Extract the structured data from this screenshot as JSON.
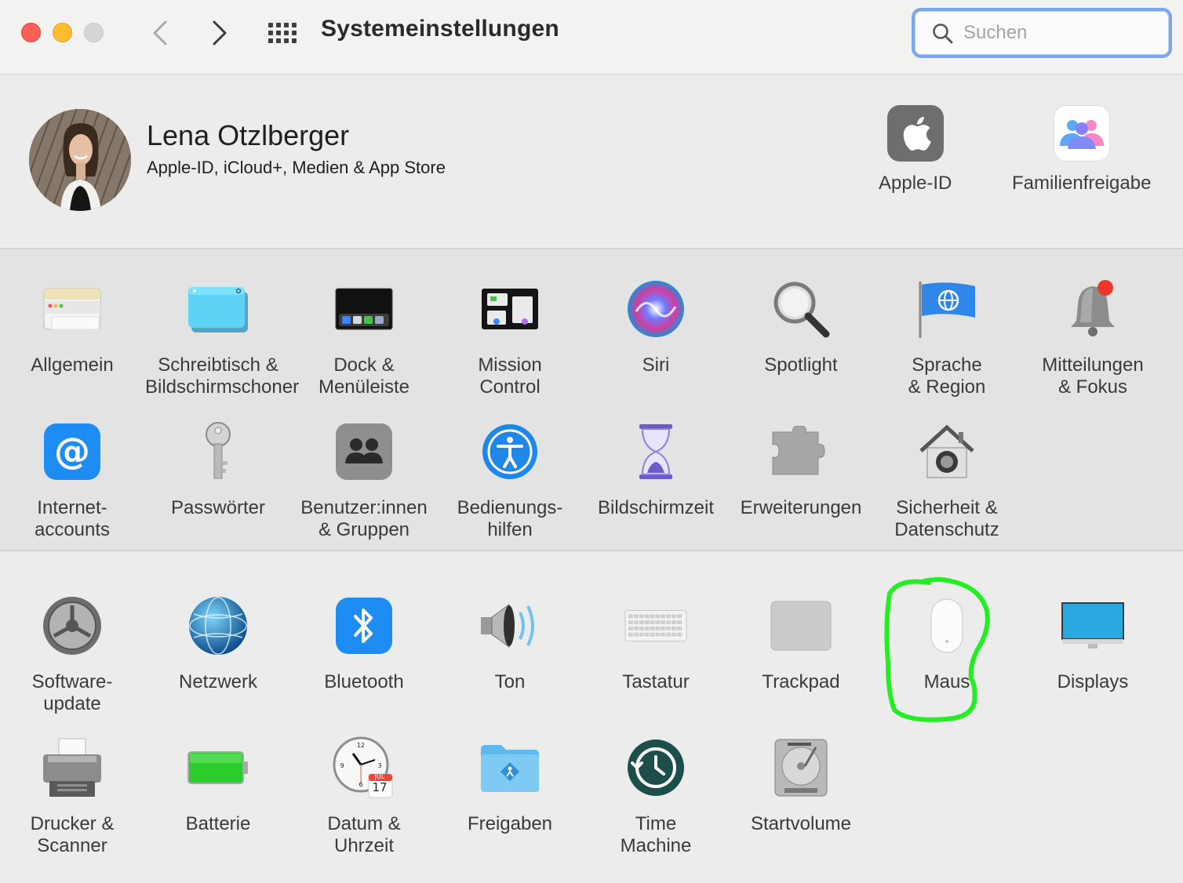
{
  "window": {
    "title": "Systemeinstellungen",
    "search_placeholder": "Suchen"
  },
  "account": {
    "name": "Lena Otzlberger",
    "subtitle": "Apple-ID, iCloud+, Medien & App Store",
    "apple_id_label": "Apple-ID",
    "family_label": "Familienfreigabe"
  },
  "row1": [
    {
      "l1": "Allgemein",
      "l2": "",
      "icon": "general-icon"
    },
    {
      "l1": "Schreibtisch &",
      "l2": "Bildschirmschoner",
      "icon": "desktop-screensaver-icon"
    },
    {
      "l1": "Dock &",
      "l2": "Menüleiste",
      "icon": "dock-icon"
    },
    {
      "l1": "Mission",
      "l2": "Control",
      "icon": "mission-control-icon"
    },
    {
      "l1": "Siri",
      "l2": "",
      "icon": "siri-icon"
    },
    {
      "l1": "Spotlight",
      "l2": "",
      "icon": "spotlight-icon"
    },
    {
      "l1": "Sprache",
      "l2": "& Region",
      "icon": "language-region-icon"
    },
    {
      "l1": "Mitteilungen",
      "l2": "& Fokus",
      "icon": "notifications-icon"
    }
  ],
  "row2": [
    {
      "l1": "Internet-",
      "l2": "accounts",
      "icon": "internet-accounts-icon"
    },
    {
      "l1": "Passwörter",
      "l2": "",
      "icon": "passwords-icon"
    },
    {
      "l1": "Benutzer:innen",
      "l2": "& Gruppen",
      "icon": "users-groups-icon"
    },
    {
      "l1": "Bedienungs-",
      "l2": "hilfen",
      "icon": "accessibility-icon"
    },
    {
      "l1": "Bildschirmzeit",
      "l2": "",
      "icon": "screen-time-icon"
    },
    {
      "l1": "Erweiterungen",
      "l2": "",
      "icon": "extensions-icon"
    },
    {
      "l1": "Sicherheit &",
      "l2": "Datenschutz",
      "icon": "security-privacy-icon"
    }
  ],
  "row3": [
    {
      "l1": "Software-",
      "l2": "update",
      "icon": "software-update-icon"
    },
    {
      "l1": "Netzwerk",
      "l2": "",
      "icon": "network-icon"
    },
    {
      "l1": "Bluetooth",
      "l2": "",
      "icon": "bluetooth-icon"
    },
    {
      "l1": "Ton",
      "l2": "",
      "icon": "sound-icon"
    },
    {
      "l1": "Tastatur",
      "l2": "",
      "icon": "keyboard-icon"
    },
    {
      "l1": "Trackpad",
      "l2": "",
      "icon": "trackpad-icon"
    },
    {
      "l1": "Maus",
      "l2": "",
      "icon": "mouse-icon"
    },
    {
      "l1": "Displays",
      "l2": "",
      "icon": "displays-icon"
    }
  ],
  "row4": [
    {
      "l1": "Drucker &",
      "l2": "Scanner",
      "icon": "printer-scanner-icon"
    },
    {
      "l1": "Batterie",
      "l2": "",
      "icon": "battery-icon"
    },
    {
      "l1": "Datum &",
      "l2": "Uhrzeit",
      "icon": "date-time-icon"
    },
    {
      "l1": "Freigaben",
      "l2": "",
      "icon": "sharing-icon"
    },
    {
      "l1": "Time",
      "l2": "Machine",
      "icon": "time-machine-icon"
    },
    {
      "l1": "Startvolume",
      "l2": "",
      "icon": "startup-disk-icon"
    }
  ],
  "clock": {
    "month": "JUL",
    "day": "17"
  },
  "colors": {
    "highlight": "#22ee22",
    "search_focus": "#7aa7ec"
  }
}
